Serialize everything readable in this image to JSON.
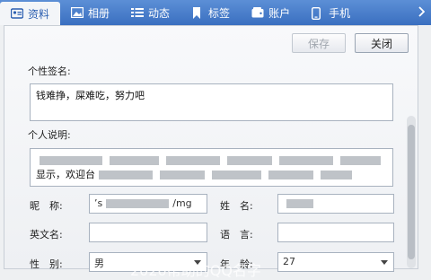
{
  "tabs": [
    {
      "label": "资料",
      "icon": "id-card-icon",
      "active": true
    },
    {
      "label": "相册",
      "icon": "photo-icon",
      "active": false
    },
    {
      "label": "动态",
      "icon": "list-icon",
      "active": false
    },
    {
      "label": "标签",
      "icon": "bookmark-icon",
      "active": false
    },
    {
      "label": "账户",
      "icon": "wallet-icon",
      "active": false
    },
    {
      "label": "手机",
      "icon": "phone-icon",
      "active": false
    }
  ],
  "toolbar": {
    "save_label": "保存",
    "close_label": "关闭"
  },
  "signature": {
    "label": "个性签名:",
    "value": "钱难挣，屎难吃，努力吧"
  },
  "description": {
    "label": "个人说明:",
    "line1_start": "",
    "line2_start": "显示，欢迎台"
  },
  "fields": {
    "nickname_label": "昵　称:",
    "nickname_value": "’s",
    "nickname_value_end": "/mg",
    "name_label": "姓　名:",
    "english_name_label": "英文名:",
    "language_label": "语　言:",
    "gender_label": "性　别:",
    "gender_value": "男",
    "age_label": "年　龄:",
    "age_value": "27"
  },
  "watermark": "2020帮助的QQ名字"
}
